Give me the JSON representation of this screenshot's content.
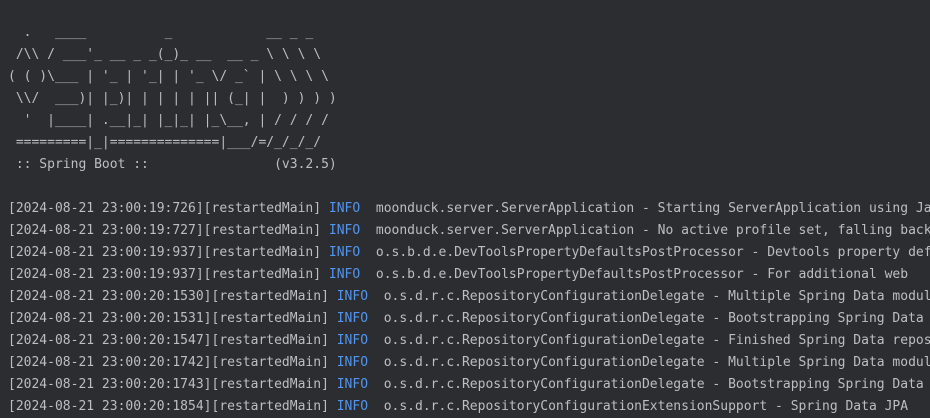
{
  "console": {
    "banner": [
      "  .   ____          _            __ _ _",
      " /\\\\ / ___'_ __ _ _(_)_ __  __ _ \\ \\ \\ \\",
      "( ( )\\___ | '_ | '_| | '_ \\/ _` | \\ \\ \\ \\",
      " \\\\/  ___)| |_)| | | | | || (_| |  ) ) ) )",
      "  '  |____| .__|_| |_|_| |_\\__, | / / / /",
      " =========|_|==============|___/=/_/_/_/",
      " :: Spring Boot ::                (v3.2.5)"
    ],
    "logs": [
      {
        "prefix": "[2024-08-21 23:00:19:726][restartedMain] ",
        "level": "INFO",
        "pad": "  ",
        "message": "moonduck.server.ServerApplication - Starting ServerApplication using Java"
      },
      {
        "prefix": "[2024-08-21 23:00:19:727][restartedMain] ",
        "level": "INFO",
        "pad": "  ",
        "message": "moonduck.server.ServerApplication - No active profile set, falling back"
      },
      {
        "prefix": "[2024-08-21 23:00:19:937][restartedMain] ",
        "level": "INFO",
        "pad": "  ",
        "message": "o.s.b.d.e.DevToolsPropertyDefaultsPostProcessor - Devtools property defaults"
      },
      {
        "prefix": "[2024-08-21 23:00:19:937][restartedMain] ",
        "level": "INFO",
        "pad": "  ",
        "message": "o.s.b.d.e.DevToolsPropertyDefaultsPostProcessor - For additional web"
      },
      {
        "prefix": "[2024-08-21 23:00:20:1530][restartedMain] ",
        "level": "INFO",
        "pad": "  ",
        "message": "o.s.d.r.c.RepositoryConfigurationDelegate - Multiple Spring Data modules"
      },
      {
        "prefix": "[2024-08-21 23:00:20:1531][restartedMain] ",
        "level": "INFO",
        "pad": "  ",
        "message": "o.s.d.r.c.RepositoryConfigurationDelegate - Bootstrapping Spring Data"
      },
      {
        "prefix": "[2024-08-21 23:00:20:1547][restartedMain] ",
        "level": "INFO",
        "pad": "  ",
        "message": "o.s.d.r.c.RepositoryConfigurationDelegate - Finished Spring Data repository"
      },
      {
        "prefix": "[2024-08-21 23:00:20:1742][restartedMain] ",
        "level": "INFO",
        "pad": "  ",
        "message": "o.s.d.r.c.RepositoryConfigurationDelegate - Multiple Spring Data modules"
      },
      {
        "prefix": "[2024-08-21 23:00:20:1743][restartedMain] ",
        "level": "INFO",
        "pad": "  ",
        "message": "o.s.d.r.c.RepositoryConfigurationDelegate - Bootstrapping Spring Data"
      },
      {
        "prefix": "[2024-08-21 23:00:20:1854][restartedMain] ",
        "level": "INFO",
        "pad": "  ",
        "message": "o.s.d.r.c.RepositoryConfigurationExtensionSupport - Spring Data JPA"
      }
    ]
  },
  "colors": {
    "background": "#2b2d30",
    "text": "#bcbec4",
    "info_level": "#5394ec"
  }
}
